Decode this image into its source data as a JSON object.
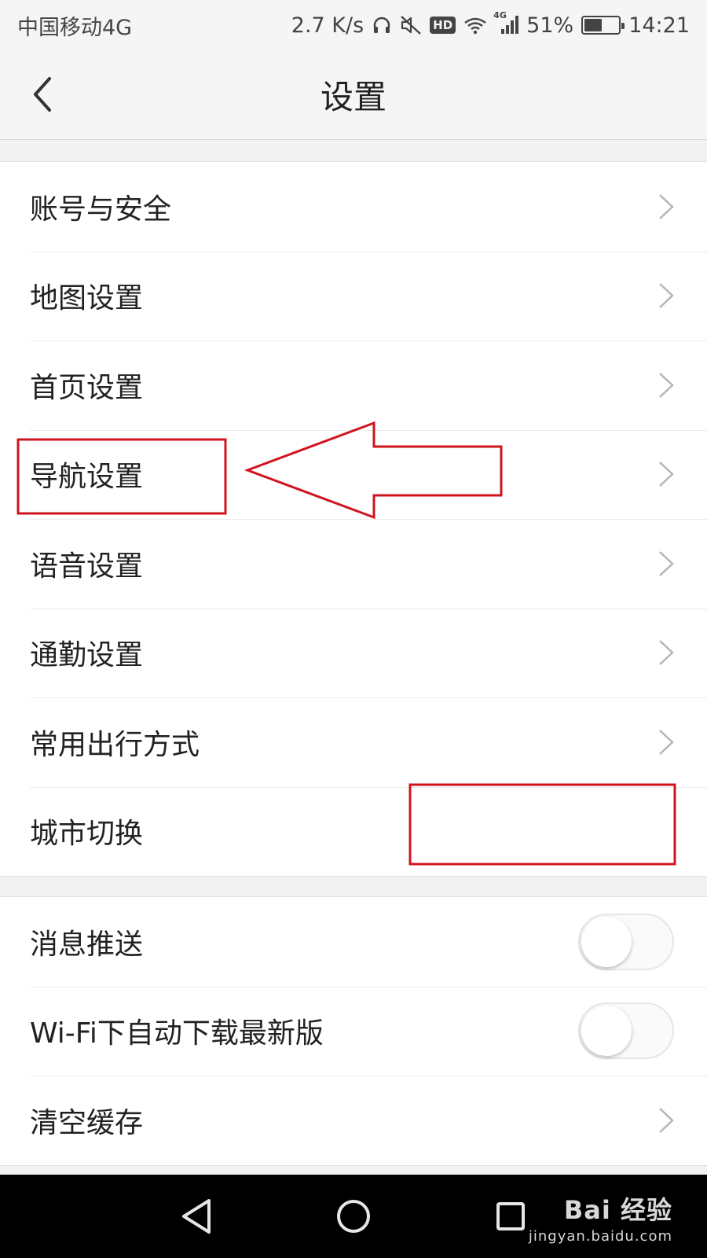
{
  "status_bar": {
    "carrier": "中国移动4G",
    "net_speed": "2.7 K/s",
    "hd_label": "HD",
    "network_type": "4G",
    "battery_percent": "51%",
    "battery_level": 0.51,
    "time": "14:21"
  },
  "header": {
    "title": "设置"
  },
  "settings_group_1": [
    {
      "label": "账号与安全"
    },
    {
      "label": "地图设置"
    },
    {
      "label": "首页设置"
    },
    {
      "label": "导航设置"
    },
    {
      "label": "语音设置"
    },
    {
      "label": "通勤设置"
    },
    {
      "label": "常用出行方式"
    },
    {
      "label": "城市切换"
    }
  ],
  "settings_group_2": {
    "push_label": "消息推送",
    "push_enabled": false,
    "wifi_download_label": "Wi-Fi下自动下载最新版",
    "wifi_download_enabled": false,
    "clear_cache_label": "清空缓存"
  },
  "watermark": {
    "brand": "Bai 经验",
    "domain": "jingyan.baidu.com"
  },
  "colors": {
    "annotation": "#d0141f",
    "chevron": "#b5b5b5",
    "background": "#f2f2f2"
  }
}
